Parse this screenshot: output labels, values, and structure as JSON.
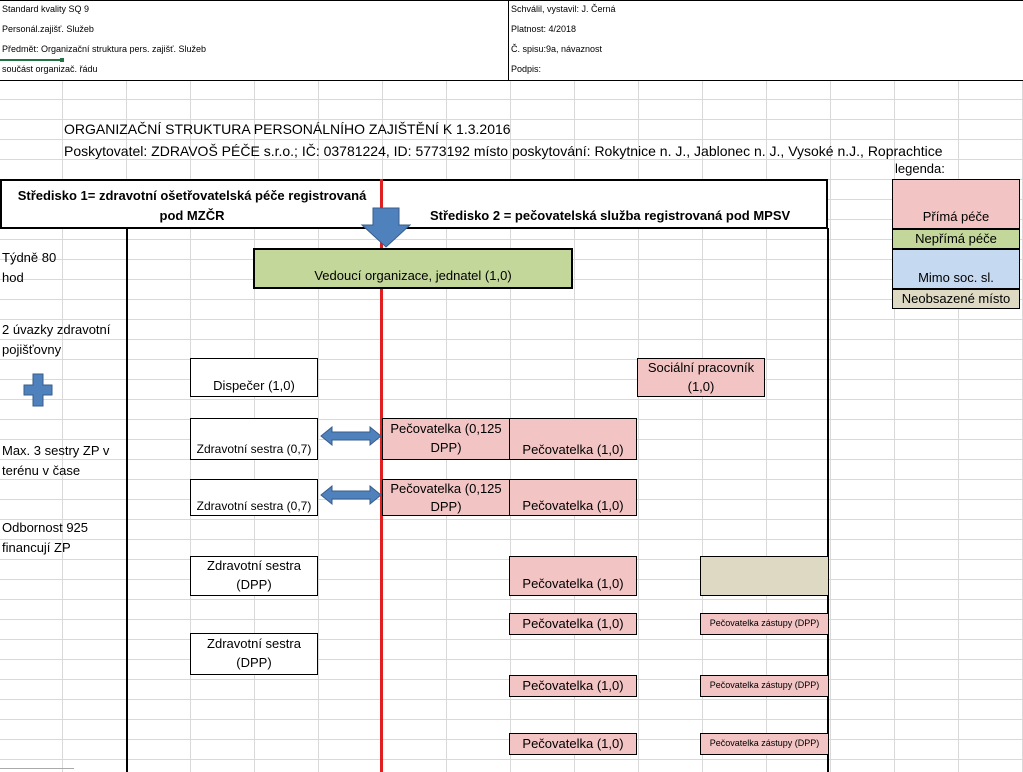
{
  "header": {
    "rows": [
      {
        "left": "Standard kvality SQ 9",
        "right": "Schválil, vystavil: J. Černá"
      },
      {
        "left": "Personál.zajišť. Služeb",
        "right": "Platnost: 4/2018"
      },
      {
        "left": "Předmět: Organizační struktura pers. zajišť. Služeb",
        "right": "Č. spisu:9a, návaznost"
      },
      {
        "left": "součást organizač. řádu",
        "right": "Podpis:"
      }
    ]
  },
  "document": {
    "title": "ORGANIZAČNÍ STRUKTURA PERSONÁLNÍHO ZAJIŠTĚNÍ K 1.3.2016",
    "provider": "Poskytovatel: ZDRAVOŠ PÉČE s.r.o.; IČ: 03781224, ID: 5773192 místo poskytování: Rokytnice n. J., Jablonec n. J., Vysoké n.J., Roprachtice"
  },
  "centers": {
    "center1": "Středisko 1=  zdravotní ošetřovatelská péče registrovaná pod MZČR",
    "center2": "Středisko 2 = pečovatelská služba registrovaná pod MPSV"
  },
  "side_notes": {
    "weekly_line1": "Týdně 80",
    "weekly_line2": "hod",
    "insurance_line1": "2 úvazky zdravotní",
    "insurance_line2": "pojišťovny",
    "nurses_line1": "Max. 3 sestry ZP v",
    "nurses_line2": "terénu v čase",
    "expertise_line1": "Odbornost 925",
    "expertise_line2": "financují ZP"
  },
  "org": {
    "head": "Vedoucí organizace, jednatel (1,0)",
    "dispatcher": "Dispečer (1,0)",
    "social_worker_line1": "Sociální pracovník",
    "social_worker_line2": "(1,0)",
    "nurse_07": "Zdravotní sestra (0,7)",
    "nurse_dpp_line1": "Zdravotní sestra",
    "nurse_dpp_line2": "(DPP)",
    "carer_0125_line1": "Pečovatelka (0,125",
    "carer_0125_line2": "DPP)",
    "carer_10": "Pečovatelka (1,0)",
    "carer_substitute": "Pečovatelka zástupy (DPP)"
  },
  "legend": {
    "title": "legenda:",
    "items": [
      {
        "label": "Přímá péče",
        "color": "#f2c4c4"
      },
      {
        "label": "Nepřímá péče",
        "color": "#c4d79b"
      },
      {
        "label": "Mimo soc. sl.",
        "color": "#c5d9f1"
      },
      {
        "label": "Neobsazené místo",
        "color": "#ddd9c3"
      }
    ]
  },
  "colors": {
    "direct_care": "#f2c4c4",
    "indirect_care": "#c4d79b",
    "outside_social": "#c5d9f1",
    "vacant": "#ddd9c3",
    "divider_line": "#e02020",
    "arrow": "#4f81bd"
  },
  "icons": {
    "down_arrow": "down-arrow-icon",
    "plus": "plus-icon",
    "double_arrow": "double-arrow-icon"
  }
}
